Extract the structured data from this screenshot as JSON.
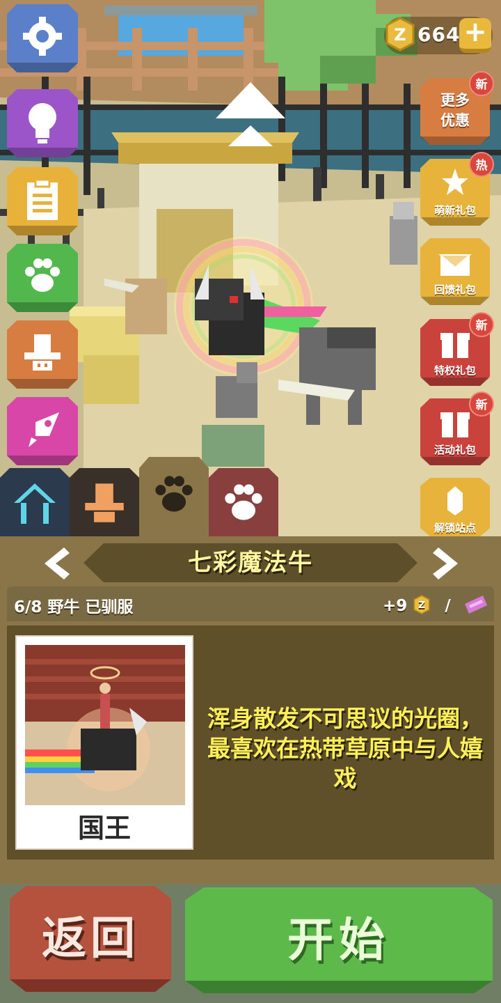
{
  "coins": {
    "value": "664",
    "add_label": "+"
  },
  "left_menu": [
    {
      "name": "settings",
      "icon": "gear-icon",
      "color": "#5b7fc9"
    },
    {
      "name": "tips",
      "icon": "lightbulb-icon",
      "color": "#9b55c9"
    },
    {
      "name": "tasks",
      "icon": "checklist-icon",
      "color": "#e8b23a"
    },
    {
      "name": "animals",
      "icon": "paw-icon",
      "color": "#52b84e"
    },
    {
      "name": "outfits",
      "icon": "hat-icon",
      "color": "#d77d42"
    },
    {
      "name": "missions",
      "icon": "rocket-icon",
      "color": "#d846a8"
    }
  ],
  "right_menu": [
    {
      "label": "更多\n优惠",
      "badge": "新",
      "icon": "",
      "color": "#d77d42"
    },
    {
      "label": "萌新礼包",
      "badge": "热",
      "icon": "stars-icon",
      "color": "#e7b33a"
    },
    {
      "label": "回馈礼包",
      "badge": "",
      "icon": "envelope-icon",
      "color": "#e7b33a"
    },
    {
      "label": "特权礼包",
      "badge": "新",
      "icon": "gift-icon",
      "color": "#c9433c"
    },
    {
      "label": "活动礼包",
      "badge": "新",
      "icon": "gift-icon",
      "color": "#c9433c"
    },
    {
      "label": "解锁站点",
      "badge": "",
      "icon": "crystal-icon",
      "color": "#e7b33a"
    }
  ],
  "tabs": [
    {
      "name": "home",
      "icon": "house-icon",
      "color": "#2b3a4c",
      "active": false
    },
    {
      "name": "outfit",
      "icon": "hat-icon",
      "color": "#3a302a",
      "active": false
    },
    {
      "name": "animals",
      "icon": "paw-icon",
      "color": "#8a7548",
      "active": true
    },
    {
      "name": "collection",
      "icon": "paw-icon",
      "color": "#8a3f3f",
      "active": false
    }
  ],
  "panel": {
    "animal_name": "七彩魔法牛",
    "tamed_status": "6/8 野牛 已驯服",
    "reward": "+9",
    "reward_separator": "/",
    "photo_caption": "国王",
    "description": "浑身散发不可思议的光圈，最喜欢在热带草原中与人嬉戏"
  },
  "buttons": {
    "back": "返回",
    "start": "开始"
  },
  "colors": {
    "panel": "#8a7548",
    "panel_dark": "#5f5029",
    "name_text": "#fff8a0",
    "desc_text": "#fff05a",
    "start": "#5db94a",
    "back": "#b4523d"
  }
}
